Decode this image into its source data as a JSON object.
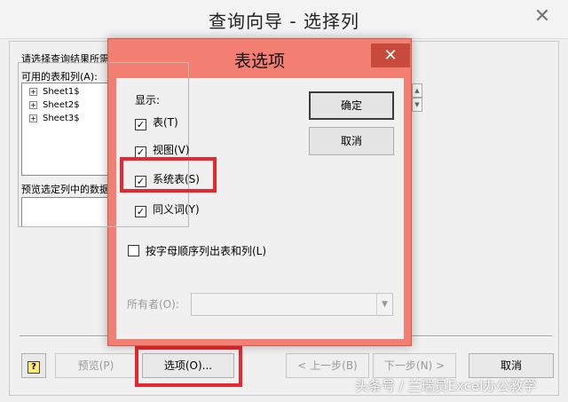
{
  "wizard": {
    "title": "查询向导 - 选择列",
    "close_glyph": "✕",
    "instruction": "请选择查询结果所需",
    "available_label": "可用的表和列(A):",
    "tables": [
      {
        "expander": "+",
        "name": "Sheet1$"
      },
      {
        "expander": "+",
        "name": "Sheet2$"
      },
      {
        "expander": "+",
        "name": "Sheet3$"
      }
    ],
    "preview_label": "预览选定列中的数据",
    "buttons": {
      "help": "?",
      "preview": "预览(P)",
      "options": "选项(O)...",
      "back": "< 上一步(B)",
      "next": "下一步(N) >",
      "cancel": "取消"
    }
  },
  "dialog": {
    "title": "表选项",
    "close_glyph": "✕",
    "display_group_label": "显示:",
    "checkboxes": [
      {
        "label": "表(T)",
        "checked": true
      },
      {
        "label": "视图(V)",
        "checked": true
      },
      {
        "label": "系统表(S)",
        "checked": true
      },
      {
        "label": "同义词(Y)",
        "checked": true
      }
    ],
    "alphabetical_label": "按字母顺序列出表和列(L)",
    "alphabetical_checked": false,
    "ok_label": "确定",
    "cancel_label": "取消",
    "owner_label": "所有者(O):",
    "owner_value": ""
  },
  "checkmark_glyph": "✓",
  "watermark": "头条号 / 兰瑞员Excel办公教学",
  "colors": {
    "dialog_frame": "#f27f71",
    "dialog_close": "#c84a3b",
    "highlight": "#e8282e"
  }
}
